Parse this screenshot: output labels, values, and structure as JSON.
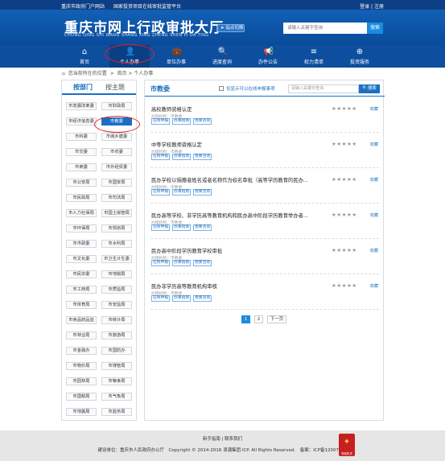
{
  "topbar": {
    "links_left": [
      "重庆市政府门户网站",
      "国家投资项目在线审批监管平台"
    ],
    "login": "登录",
    "sep": "|",
    "register": "注册"
  },
  "header": {
    "logo_cn": "重庆市网上行政审批大厅",
    "logo_en": "CHONG QING SHI WANG SHANG XING ZHENG SHEN PI DA TING",
    "location_label": "站点切换",
    "search_placeholder": "请输入关键字查询",
    "search_button": "搜索"
  },
  "nav": [
    {
      "label": "首页",
      "icon": "home-icon",
      "glyph": "⌂"
    },
    {
      "label": "个人办事",
      "icon": "person-icon",
      "glyph": "👤"
    },
    {
      "label": "单位办事",
      "icon": "briefcase-icon",
      "glyph": "💼"
    },
    {
      "label": "进度查询",
      "icon": "search-icon",
      "glyph": "🔍"
    },
    {
      "label": "办件公告",
      "icon": "megaphone-icon",
      "glyph": "📢"
    },
    {
      "label": "权力清单",
      "icon": "list-icon",
      "glyph": "≡"
    },
    {
      "label": "投资服务",
      "icon": "invest-icon",
      "glyph": "⊕"
    }
  ],
  "breadcrumb": {
    "prefix": "您当前所在的位置",
    "path": "首页 > 个人办事"
  },
  "left_panel": {
    "tab_department": "按部门",
    "tab_theme": "按主题",
    "departments": [
      "市发展改革委",
      "市财政局",
      "市经济信息委",
      "市教委",
      "市科委",
      "市城乡建委",
      "市交委",
      "市农委",
      "市商委",
      "市外经贸委",
      "市公安局",
      "市国安局",
      "市民政局",
      "市司法局",
      "市人力社保局",
      "市国土房管局",
      "市环保局",
      "市规划局",
      "市市政委",
      "市水利局",
      "市文化委",
      "市卫生计生委",
      "市民宗委",
      "市地税局",
      "市工商局",
      "市质监局",
      "市体育局",
      "市安监局",
      "市食品药品监",
      "市统计局",
      "市林业局",
      "市旅游局",
      "市金融办",
      "市国防办",
      "市物价局",
      "市煤管局",
      "市园林局",
      "市粮食局",
      "市国税局",
      "市气象局",
      "市地震局",
      "市盐务局"
    ],
    "selected": "市教委"
  },
  "main_panel": {
    "title": "市教委",
    "checkbox_label": "仅显示可以在线申报事项",
    "search_placeholder": "请输入关键字查询",
    "search_button": "搜索",
    "items": [
      {
        "name": "高校教师资格认定",
        "org": "办理机构：市教委",
        "tags": [
          "在线申报",
          "办事指南",
          "我要咨询"
        ],
        "stars": "★★★★★",
        "fav": "收藏"
      },
      {
        "name": "中等学校教师资格认定",
        "org": "办理机构：市教委",
        "tags": [
          "在线申报",
          "办事指南",
          "我要咨询"
        ],
        "stars": "★★★★★",
        "fav": "收藏"
      },
      {
        "name": "民办学校以捐赠者姓名或者名称作为校名审批（高等学历教育的民办...",
        "org": "办理机构：市教委",
        "tags": [
          "在线申报",
          "办事指南",
          "我要咨询"
        ],
        "stars": "★★★★★",
        "fav": "收藏"
      },
      {
        "name": "民办高等学校、非学历高等教育机构和民办高中阶段学历教育举办者...",
        "org": "办理机构：市教委",
        "tags": [
          "在线申报",
          "办事指南",
          "我要咨询"
        ],
        "stars": "★★★★★",
        "fav": "收藏"
      },
      {
        "name": "民办高中阶段学历教育学校审批",
        "org": "办理机构：市教委",
        "tags": [
          "在线申报",
          "办事指南",
          "我要咨询"
        ],
        "stars": "★★★★★",
        "fav": "收藏"
      },
      {
        "name": "民办非学历高等教育机构审核",
        "org": "办理机构：市教委",
        "tags": [
          "在线申报",
          "办事指南",
          "我要咨询"
        ],
        "stars": "★★★★★",
        "fav": "收藏"
      }
    ],
    "pager": {
      "pages": [
        "1",
        "2"
      ],
      "current": "1",
      "next": "下一页"
    }
  },
  "footer": {
    "line1": "新手指南 | 联系我们",
    "line2": "建设单位：重庆市人民政府办公厅　Copyright © 2014-2016 浪潮集团 ICP. All Rights Reserved.　备案：ICP备12007387",
    "badge_text": "党政机关",
    "badge_glyph": "✦"
  },
  "colors": {
    "primary": "#1a6fc4",
    "header_bg": "#0d4e9e",
    "highlight_oval": "#e21f26"
  }
}
